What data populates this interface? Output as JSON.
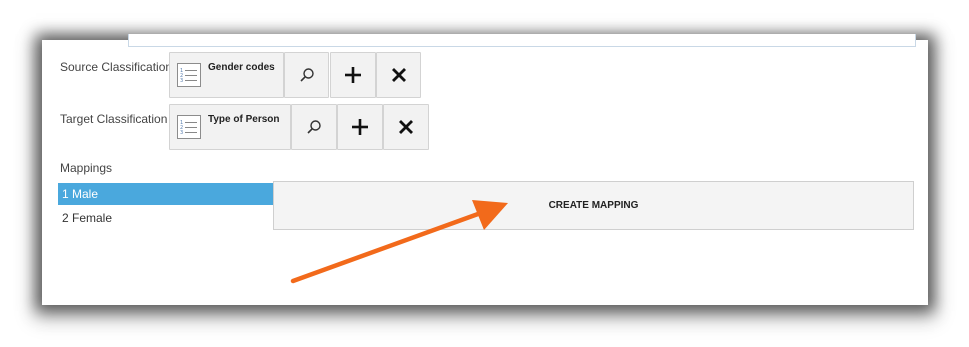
{
  "source": {
    "label": "Source Classification",
    "value": "Gender codes"
  },
  "target": {
    "label": "Target Classification",
    "value": "Type of Person"
  },
  "mappings": {
    "label": "Mappings",
    "items": [
      {
        "label": "1 Male",
        "selected": true
      },
      {
        "label": "2 Female",
        "selected": false
      }
    ]
  },
  "create_mapping_label": "CREATE MAPPING",
  "icons": {
    "list": "classification-list-icon",
    "search": "search-icon",
    "add": "add-icon",
    "remove": "close-icon"
  },
  "colors": {
    "selection": "#4aa8dd",
    "annotation_arrow": "#f26a1b"
  }
}
